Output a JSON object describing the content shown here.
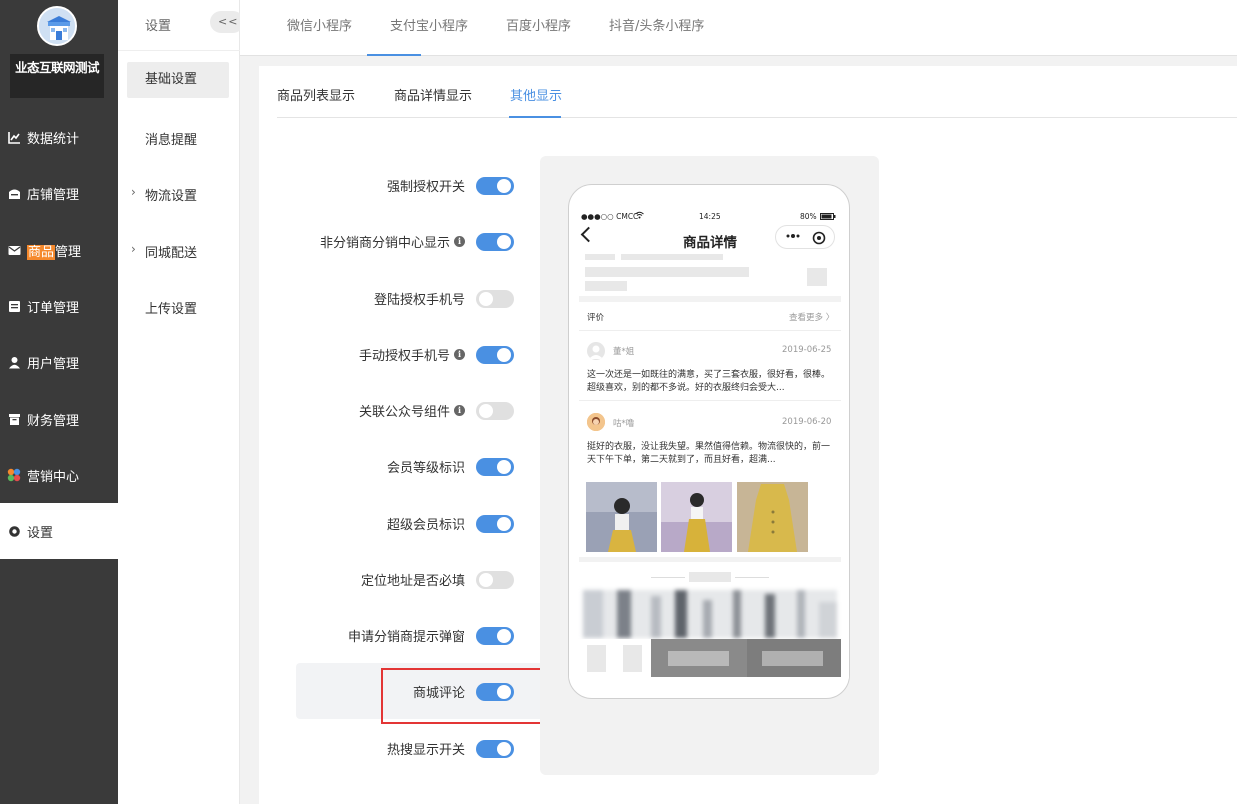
{
  "nav": {
    "store_name": "业态互联网测试",
    "items": [
      {
        "label": "数据统计",
        "icon": "line-chart-icon"
      },
      {
        "label": "店铺管理",
        "icon": "shop-icon"
      },
      {
        "label_highlight": "商品",
        "label_rest": "管理",
        "icon": "mail-icon"
      },
      {
        "label": "订单管理",
        "icon": "order-list-icon"
      },
      {
        "label": "用户管理",
        "icon": "user-icon"
      },
      {
        "label": "财务管理",
        "icon": "finance-icon"
      },
      {
        "label": "营销中心",
        "icon": "marketing-icon"
      },
      {
        "label": "设置",
        "icon": "gear-icon"
      }
    ]
  },
  "subnav": {
    "title": "设置",
    "collapse_label": "<<",
    "items": [
      {
        "label": "基础设置",
        "active": true
      },
      {
        "label": "消息提醒"
      },
      {
        "label": "物流设置",
        "has_arrow": true
      },
      {
        "label": "同城配送",
        "has_arrow": true
      },
      {
        "label": "上传设置"
      }
    ],
    "arrow": "›"
  },
  "top_tabs": [
    {
      "label": "微信小程序"
    },
    {
      "label": "支付宝小程序",
      "active": true
    },
    {
      "label": "百度小程序"
    },
    {
      "label": "抖音/头条小程序"
    }
  ],
  "section_tabs": [
    {
      "label": "商品列表显示"
    },
    {
      "label": "商品详情显示"
    },
    {
      "label": "其他显示",
      "active": true
    }
  ],
  "settings": [
    {
      "label": "强制授权开关",
      "on": true
    },
    {
      "label": "非分销商分销中心显示",
      "info": true,
      "on": true
    },
    {
      "label": "登陆授权手机号",
      "on": false
    },
    {
      "label": "手动授权手机号",
      "info": true,
      "on": true
    },
    {
      "label": "关联公众号组件",
      "info": true,
      "on": false
    },
    {
      "label": "会员等级标识",
      "on": true
    },
    {
      "label": "超级会员标识",
      "on": true
    },
    {
      "label": "定位地址是否必填",
      "on": false
    },
    {
      "label": "申请分销商提示弹窗",
      "on": true
    },
    {
      "label": "商城评论",
      "on": true,
      "highlighted": true
    },
    {
      "label": "热搜显示开关",
      "on": true
    }
  ],
  "info_glyph": "i",
  "phone": {
    "status_left": "●●●○○ CMCC",
    "status_time": "14:25",
    "status_right": "80%",
    "title": "商品详情",
    "reviews_label": "评价",
    "see_more": "查看更多 〉",
    "reviews": [
      {
        "user": "董*姐",
        "date": "2019-06-25",
        "text": "这一次还是一如既往的满意，买了三套衣服，很好看，很棒。超级喜欢，别的都不多说。好的衣服终归会受大..."
      },
      {
        "user": "咕*噜",
        "date": "2019-06-20",
        "text": "挺好的衣服，没让我失望。果然值得信赖。物流很快的，前一天下午下单，第二天就到了，而且好看，超满..."
      }
    ]
  },
  "colors": {
    "accent": "#4a90e2",
    "nav_bg": "#3a3a3a",
    "highlight_box": "#e33535",
    "nav_highlight": "#f5892d"
  }
}
